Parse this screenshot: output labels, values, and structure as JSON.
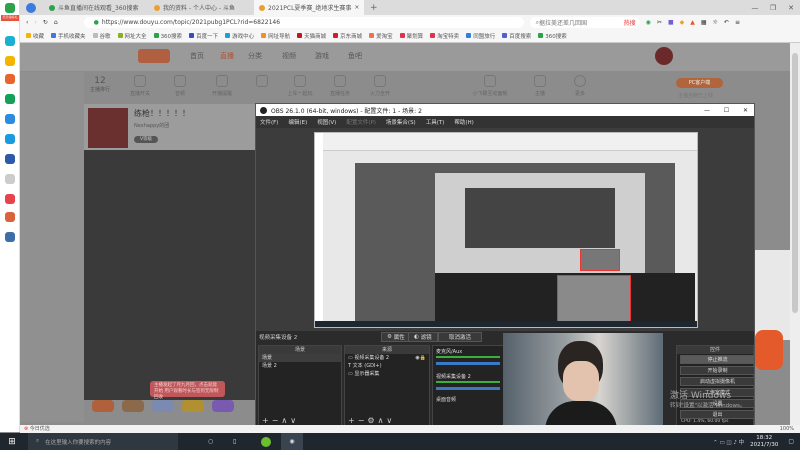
{
  "browser": {
    "tabs": [
      {
        "label": "斗鱼直播间在线观看_360搜索"
      },
      {
        "label": "我的资料 - 个人中心 - 斗鱼"
      },
      {
        "label": "2021PCL夏季赛_绝地求生赛事"
      }
    ],
    "url": "https://www.douyu.com/topic/2021pubg1PCL?rid=6822146",
    "search_placeholder": "据拉美还差几回国",
    "hot_label": "热搜",
    "bookmarks": [
      "收藏",
      "手机收藏夹",
      "谷歌",
      "网址大全",
      "360搜索",
      "百度一下",
      "游戏中心",
      "网址导航",
      "天猫商城",
      "京东商城",
      "爱淘宝",
      "聚划算",
      "淘宝特卖",
      "同盟旅行",
      "百度搜索",
      "360搜索"
    ]
  },
  "sidebar360": {
    "badge": "天天领好礼"
  },
  "douyu": {
    "nav": [
      "首页",
      "直播",
      "分类",
      "视频",
      "游戏",
      "鱼吧"
    ],
    "toolbar": {
      "count": "12",
      "count_label": "主播排行",
      "items": [
        "直播开关",
        "音频",
        "开播提醒",
        "",
        "上车一起玩",
        "直播任务",
        "火力全开",
        "",
        "小飞碟互动面板",
        "主播",
        "更多"
      ]
    },
    "pc_button": "PC客户端",
    "pc_sub": "主播自制已上线",
    "streamer": {
      "title": "练枪！！！！！",
      "tag": "Nexhappy的团",
      "level": "V等级"
    },
    "toast": "主播发起了月九月回，点击就能开始 用户观看时长与签到无限制回收"
  },
  "obs": {
    "title": "OBS 26.1.0 (64-bit, windows) - 配置文件: 1 - 场景: 2",
    "menu": [
      "文件(F)",
      "编辑(E)",
      "视图(V)",
      "配置文件(P)",
      "场景集合(S)",
      "工具(T)",
      "帮助(H)"
    ],
    "context_source": "视频采集设备 2",
    "properties": "属性",
    "filters": "滤镜",
    "deactivate": "取消激活",
    "scenes_header": "场景",
    "scenes": [
      "场景",
      "场景 2"
    ],
    "sources_header": "来源",
    "sources": [
      "视频采集设备 2",
      "文本 (GDI+)",
      "显示器采集"
    ],
    "mixer": [
      "麦克风/Aux",
      "视频采集设备 2",
      "桌面音频"
    ],
    "controls_header": "控件",
    "controls": [
      "停止推流",
      "开始录制",
      "启动虚拟摄像机",
      "工作室模式",
      "设置",
      "退出"
    ],
    "stats": "CPU: 1.4%, 60.00 fps"
  },
  "watermark": {
    "line1": "激活 Windows",
    "line2": "转到\"设置\"以激活 Windows。"
  },
  "statusbar": {
    "left": "今日优选",
    "zoom": "100%"
  },
  "taskbar": {
    "search_placeholder": "在这里输入你要搜索的内容",
    "time": "18:32",
    "date": "2021/7/30"
  }
}
